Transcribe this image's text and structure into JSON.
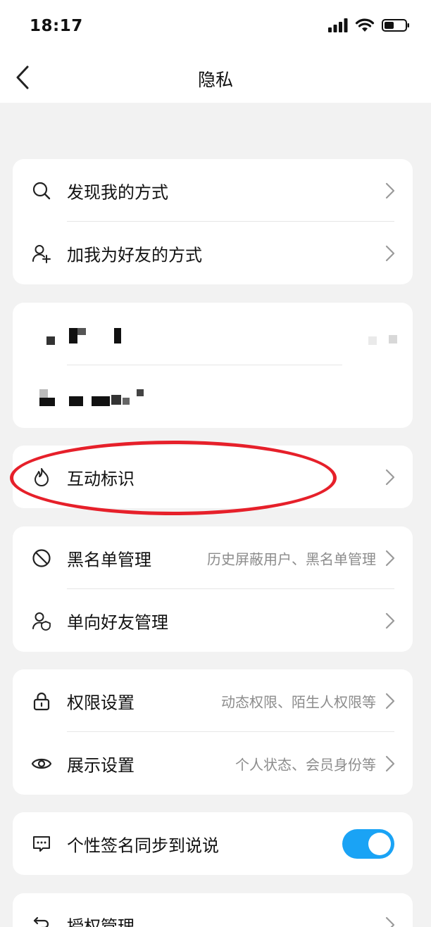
{
  "status": {
    "time": "18:17"
  },
  "nav": {
    "title": "隐私"
  },
  "group1": {
    "items": [
      {
        "label": "发现我的方式"
      },
      {
        "label": "加我为好友的方式"
      }
    ]
  },
  "group3": {
    "items": [
      {
        "label": "互动标识"
      }
    ]
  },
  "group4": {
    "items": [
      {
        "label": "黑名单管理",
        "value": "历史屏蔽用户、黑名单管理"
      },
      {
        "label": "单向好友管理"
      }
    ]
  },
  "group5": {
    "items": [
      {
        "label": "权限设置",
        "value": "动态权限、陌生人权限等"
      },
      {
        "label": "展示设置",
        "value": "个人状态、会员身份等"
      }
    ]
  },
  "group6": {
    "items": [
      {
        "label": "个性签名同步到说说",
        "toggle_on": true
      }
    ]
  },
  "group7": {
    "items": [
      {
        "label": "授权管理"
      }
    ]
  },
  "colors": {
    "accent": "#1aa3f5",
    "annotation": "#e6202a"
  },
  "icons": {
    "search": "search-icon",
    "add_friend": "add-person-icon",
    "flame": "flame-icon",
    "block": "block-icon",
    "person_shield": "person-shield-icon",
    "lock": "lock-icon",
    "eye": "eye-icon",
    "comment": "comment-icon",
    "link": "link-icon",
    "chevron": "chevron-right-icon"
  }
}
